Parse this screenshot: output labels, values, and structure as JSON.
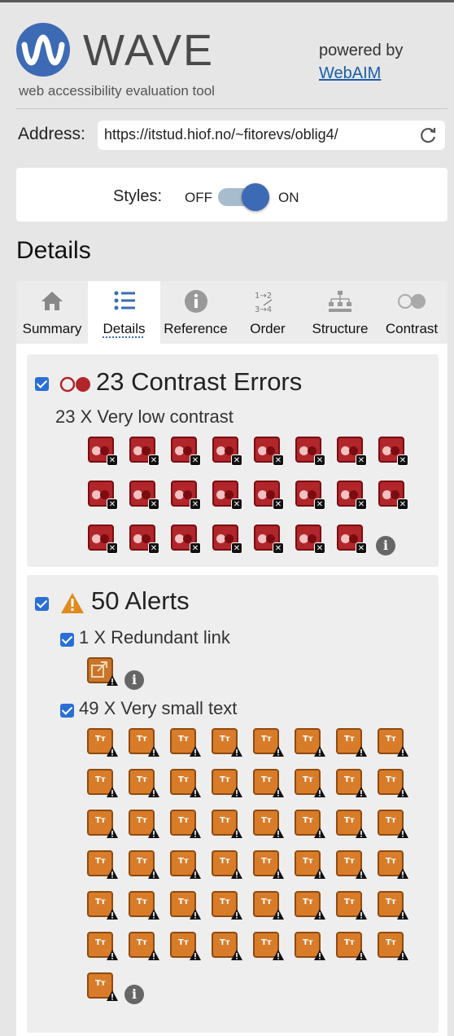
{
  "header": {
    "app_title": "WAVE",
    "subtitle": "web accessibility evaluation tool",
    "powered_by": "powered by",
    "webaim_link": "WebAIM"
  },
  "address": {
    "label": "Address:",
    "value": "https://itstud.hiof.no/~fitorevs/oblig4/",
    "reload_icon": "reload-icon"
  },
  "styles": {
    "label": "Styles:",
    "off": "OFF",
    "on": "ON",
    "state": "on"
  },
  "page_title": "Details",
  "tabs": [
    {
      "label": "Summary",
      "icon": "home-icon"
    },
    {
      "label": "Details",
      "icon": "list-icon",
      "active": true
    },
    {
      "label": "Reference",
      "icon": "info-icon"
    },
    {
      "label": "Order",
      "icon": "order-icon"
    },
    {
      "label": "Structure",
      "icon": "structure-icon"
    },
    {
      "label": "Contrast",
      "icon": "contrast-icon"
    }
  ],
  "contrast": {
    "title": "23 Contrast Errors",
    "item_label": "23 X Very low contrast",
    "count": 23
  },
  "alerts": {
    "title": "50 Alerts",
    "redundant_label": "1 X Redundant link",
    "redundant_count": 1,
    "small_text_label": "49 X Very small text",
    "small_text_count": 49
  },
  "colors": {
    "brand_blue": "#3d6ab4",
    "error_red": "#b1262b",
    "alert_orange": "#d87c2a"
  }
}
